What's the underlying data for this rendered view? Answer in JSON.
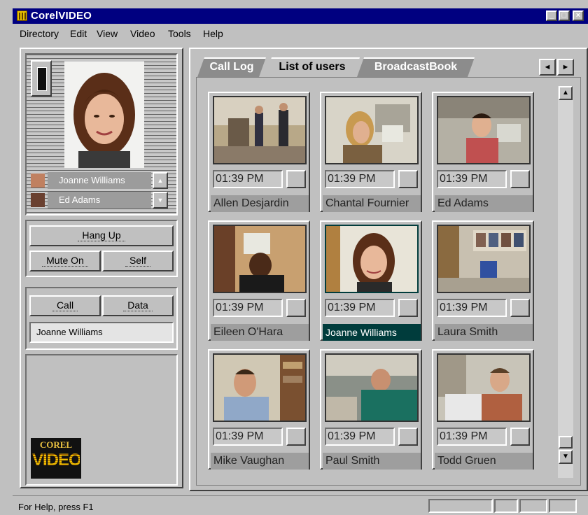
{
  "window": {
    "title": "CorelVIDEO",
    "controls": {
      "minimize": "_",
      "maximize": "□",
      "close": "×"
    }
  },
  "menu": [
    "Directory",
    "Edit",
    "View",
    "Video",
    "Tools",
    "Help"
  ],
  "left": {
    "speakers": [
      {
        "name": "Joanne Williams"
      },
      {
        "name": "Ed Adams"
      }
    ],
    "buttons": {
      "hangup": "Hang Up",
      "mute": "Mute On",
      "self": "Self",
      "call": "Call",
      "data": "Data"
    },
    "call_field": "Joanne Williams",
    "logo_top": "COREL",
    "logo_bottom": "VIDEO"
  },
  "tabs": [
    {
      "label": "Call Log",
      "active": false
    },
    {
      "label": "List of users",
      "active": true
    },
    {
      "label": "BroadcastBook",
      "active": false
    }
  ],
  "tab_scroll": {
    "left": "◄",
    "right": "►"
  },
  "users": [
    {
      "name": "Allen Desjardin",
      "time": "01:39 PM",
      "selected": false
    },
    {
      "name": "Chantal Fournier",
      "time": "01:39 PM",
      "selected": false
    },
    {
      "name": "Ed Adams",
      "time": "01:39 PM",
      "selected": false
    },
    {
      "name": "Eileen O'Hara",
      "time": "01:39 PM",
      "selected": false
    },
    {
      "name": "Joanne Williams",
      "time": "01:39 PM",
      "selected": true
    },
    {
      "name": "Laura Smith",
      "time": "01:39 PM",
      "selected": false
    },
    {
      "name": "Mike Vaughan",
      "time": "01:39 PM",
      "selected": false
    },
    {
      "name": "Paul Smith",
      "time": "01:39 PM",
      "selected": false
    },
    {
      "name": "Todd Gruen",
      "time": "01:39 PM",
      "selected": false
    }
  ],
  "scroll": {
    "up": "▲",
    "down": "▼"
  },
  "status": {
    "text": "For Help, press F1"
  },
  "colors": {
    "titlebar": "#000080",
    "selected_name": "#003c3c"
  }
}
